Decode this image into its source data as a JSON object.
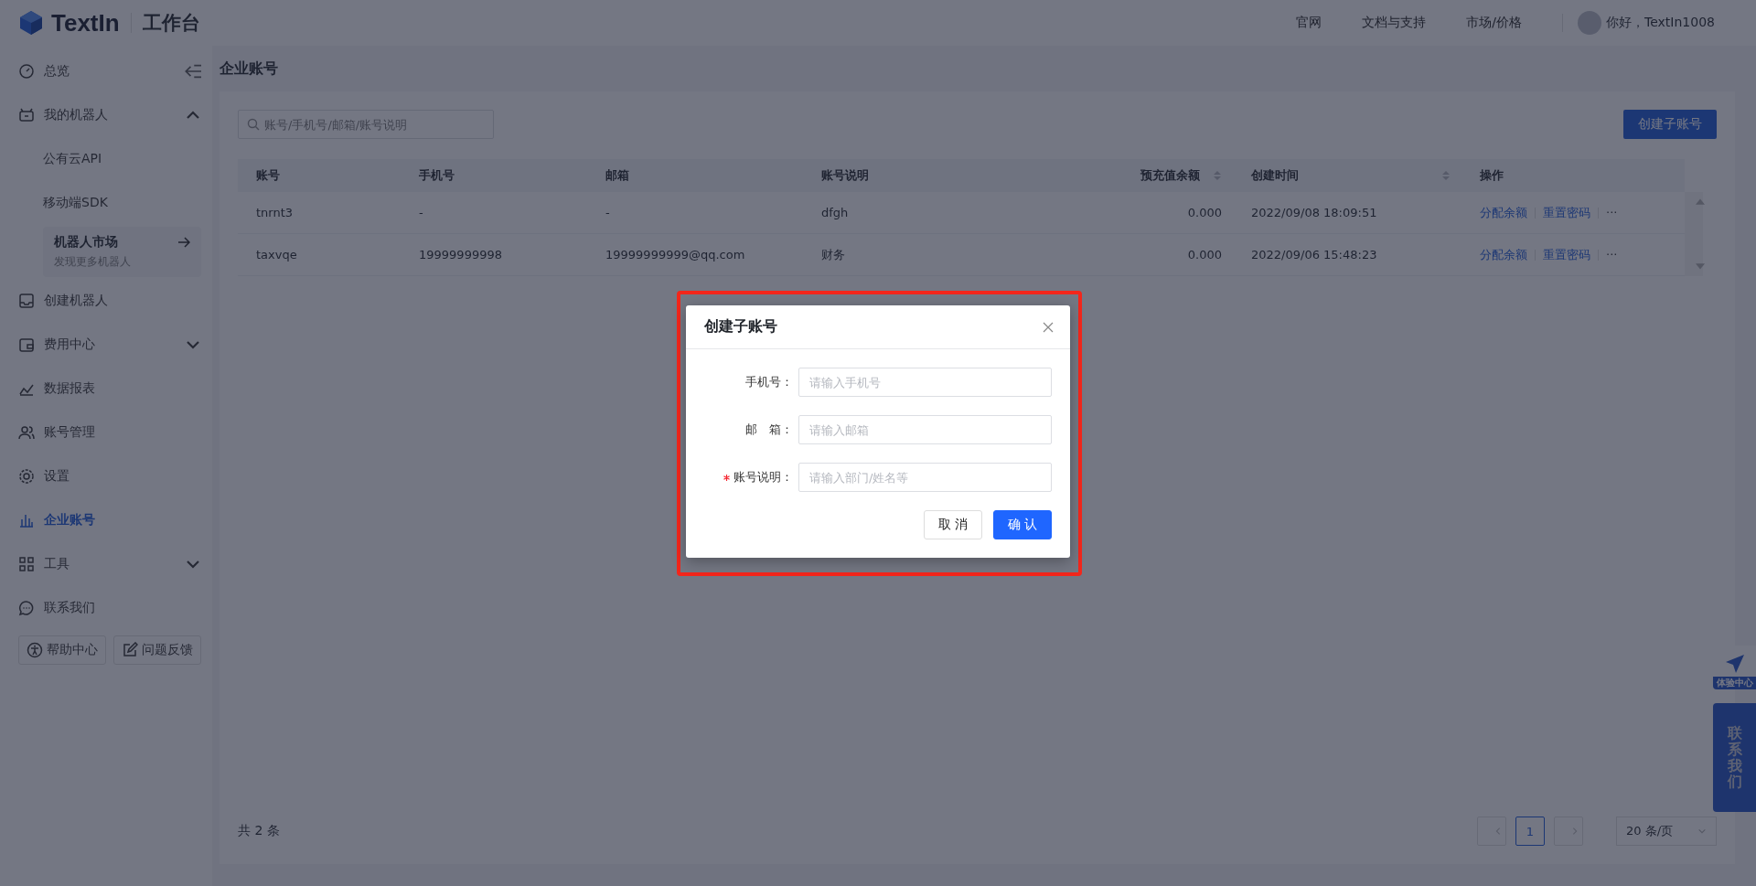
{
  "header": {
    "logo": "TextIn",
    "title": "工作台",
    "nav": [
      "官网",
      "文档与支持",
      "市场/价格"
    ],
    "greeting": "你好，TextIn1008"
  },
  "sidebar": {
    "items": [
      {
        "kind": "link",
        "label": "总览",
        "selected": false
      },
      {
        "kind": "group",
        "label": "我的机器人",
        "expanded": true,
        "selected": false
      },
      {
        "kind": "sub",
        "label": "公有云API",
        "selected": false
      },
      {
        "kind": "sub",
        "label": "移动端SDK",
        "selected": false
      },
      {
        "kind": "feature",
        "label": "机器人市场",
        "subtitle": "发现更多机器人",
        "selected": false
      },
      {
        "kind": "link",
        "label": "创建机器人",
        "selected": false
      },
      {
        "kind": "group",
        "label": "费用中心",
        "expanded": false,
        "selected": false
      },
      {
        "kind": "link",
        "label": "数据报表",
        "selected": false
      },
      {
        "kind": "link",
        "label": "账号管理",
        "selected": false
      },
      {
        "kind": "link",
        "label": "设置",
        "selected": false
      },
      {
        "kind": "link",
        "label": "企业账号",
        "selected": true
      },
      {
        "kind": "group",
        "label": "工具",
        "expanded": false,
        "selected": false
      },
      {
        "kind": "link",
        "label": "联系我们",
        "selected": false
      }
    ],
    "buttons": [
      "帮助中心",
      "问题反馈"
    ]
  },
  "page": {
    "title": "企业账号",
    "search": {
      "placeholder": "账号/手机号/邮箱/账号说明"
    },
    "create_button": "创建子账号"
  },
  "table": {
    "columns": [
      {
        "label": "账号",
        "sortable": false
      },
      {
        "label": "手机号",
        "sortable": false
      },
      {
        "label": "邮箱",
        "sortable": false
      },
      {
        "label": "账号说明",
        "sortable": false
      },
      {
        "label": "预充值余额",
        "sortable": true
      },
      {
        "label": "创建时间",
        "sortable": true
      },
      {
        "label": "操作",
        "sortable": false
      }
    ],
    "rows": [
      {
        "cells": [
          "tnrnt3",
          "-",
          "-",
          "dfgh",
          "0.000",
          "2022/09/08 18:09:51"
        ],
        "actions": [
          "分配余额",
          "重置密码",
          "···"
        ]
      },
      {
        "cells": [
          "taxvqe",
          "19999999998",
          "19999999999@qq.com",
          "财务",
          "0.000",
          "2022/09/06 15:48:23"
        ],
        "actions": [
          "分配余额",
          "重置密码",
          "···"
        ]
      }
    ]
  },
  "pagination": {
    "total": "共 2 条",
    "pages": [
      {
        "label": "1",
        "selected": true
      }
    ],
    "page_size": "20 条/页"
  },
  "floating": {
    "experience": "体验中心",
    "contact": "联系我们"
  },
  "modal": {
    "title": "创建子账号",
    "fields": [
      {
        "label": "手机号：",
        "placeholder": "请输入手机号",
        "required": false
      },
      {
        "label": "邮　箱：",
        "placeholder": "请输入邮箱",
        "required": false
      },
      {
        "label": "账号说明：",
        "placeholder": "请输入部门/姓名等",
        "required": true
      }
    ],
    "cancel": "取 消",
    "confirm": "确 认"
  }
}
